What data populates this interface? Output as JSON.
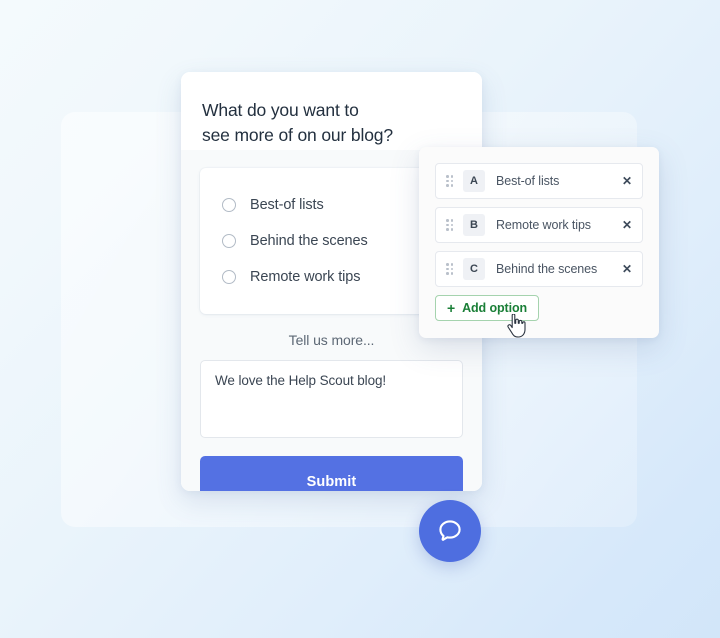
{
  "background": {
    "gradient_from": "#f4fafd",
    "gradient_to": "#d2e6f9"
  },
  "form_card": {
    "title": "What do you want to\nsee more of on our blog?",
    "radio_options": [
      {
        "label": "Best-of lists"
      },
      {
        "label": "Behind the scenes"
      },
      {
        "label": "Remote work tips"
      }
    ],
    "tell_more_label": "Tell us more...",
    "textarea_value": "We love the Help Scout blog!",
    "textarea_placeholder": "Tell us more...",
    "submit_label": "Submit",
    "submit_color": "#5471e3"
  },
  "options_panel": {
    "options": [
      {
        "key": "A",
        "text": "Best-of lists",
        "remove_label": "✕"
      },
      {
        "key": "B",
        "text": "Remote work tips",
        "remove_label": "✕"
      },
      {
        "key": "C",
        "text": "Behind the scenes",
        "remove_label": "✕"
      }
    ],
    "add_option_label": "Add option",
    "add_option_plus": "+",
    "add_option_color": "#1a7f37"
  },
  "chat_fab": {
    "icon": "chat-bubble-icon",
    "color": "#4e6ee0"
  },
  "cursor": {
    "icon": "pointing-hand-cursor"
  }
}
